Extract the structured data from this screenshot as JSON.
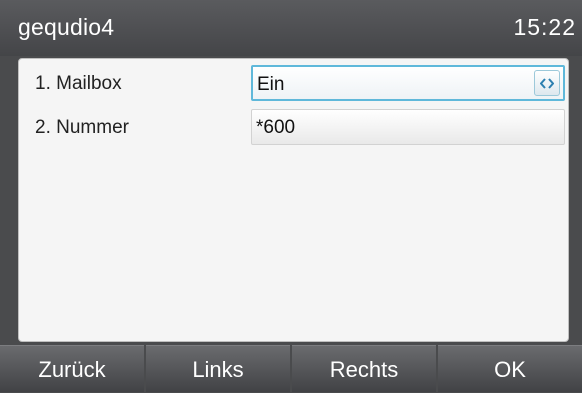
{
  "header": {
    "title": "gequdio4",
    "time": "15:22"
  },
  "settings": [
    {
      "label": "1. Mailbox",
      "value": "Ein"
    },
    {
      "label": "2. Nummer",
      "value": "*600"
    }
  ],
  "softkeys": [
    "Zurück",
    "Links",
    "Rechts",
    "OK"
  ],
  "icons": {
    "switch": "left-right-arrows-icon"
  },
  "colors": {
    "accent": "#5fb8da",
    "titlebar": "#4a4b4d",
    "panel": "#f5f5f5"
  }
}
